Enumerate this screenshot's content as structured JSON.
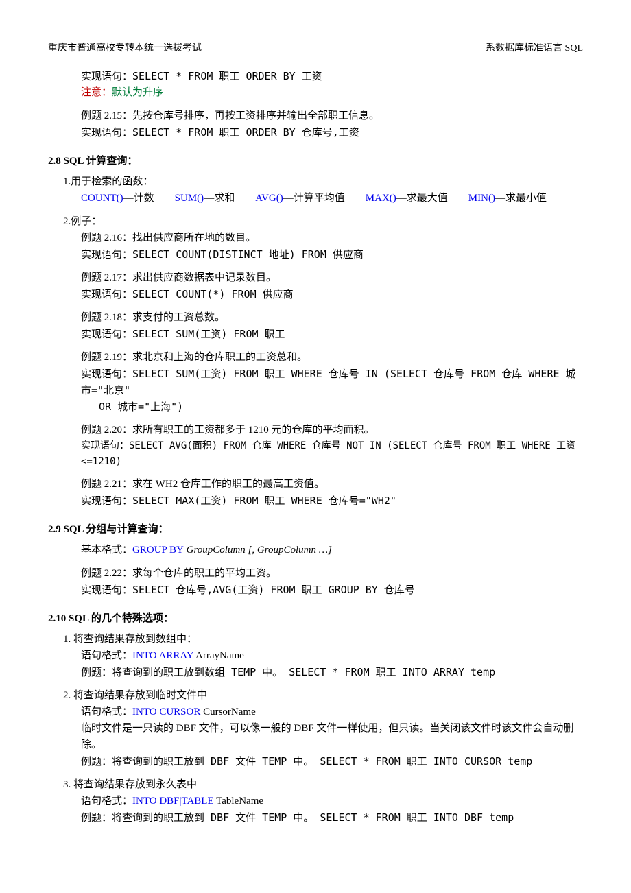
{
  "header": {
    "left": "重庆市普通高校专转本统一选拔考试",
    "right": "系数据库标准语言 SQL"
  },
  "top": {
    "l1": "实现语句：SELECT * FROM 职工 ORDER BY 工资",
    "l2a": "注意：",
    "l2b": "默认为升序",
    "l3": "例题 2.15：先按仓库号排序，再按工资排序并输出全部职工信息。",
    "l4": "实现语句：SELECT * FROM 职工 ORDER BY 仓库号,工资"
  },
  "s28": {
    "title": "2.8 SQL 计算查询：",
    "i1": "1.用于检索的函数：",
    "funcs": [
      {
        "fn": "COUNT()",
        "desc": "—计数"
      },
      {
        "fn": "SUM()",
        "desc": "—求和"
      },
      {
        "fn": "AVG()",
        "desc": "—计算平均值"
      },
      {
        "fn": "MAX()",
        "desc": "—求最大值"
      },
      {
        "fn": "MIN()",
        "desc": "—求最小值"
      }
    ],
    "i2": "2.例子：",
    "e16a": "例题 2.16：找出供应商所在地的数目。",
    "e16b": "实现语句：SELECT COUNT(DISTINCT 地址) FROM 供应商",
    "e17a": "例题 2.17：求出供应商数据表中记录数目。",
    "e17b": "实现语句：SELECT COUNT(*) FROM 供应商",
    "e18a": "例题 2.18：求支付的工资总数。",
    "e18b": "实现语句：SELECT SUM(工资) FROM 职工",
    "e19a": "例题 2.19：求北京和上海的仓库职工的工资总和。",
    "e19b": "实现语句：SELECT SUM(工资) FROM 职工 WHERE 仓库号 IN (SELECT 仓库号 FROM 仓库 WHERE 城市=\"北京\"",
    "e19c": "OR 城市=\"上海\")",
    "e20a": "例题 2.20：求所有职工的工资都多于 1210 元的仓库的平均面积。",
    "e20b": "实现语句：SELECT AVG(面积) FROM 仓库 WHERE 仓库号 NOT IN (SELECT 仓库号 FROM 职工 WHERE 工资<=1210)",
    "e21a": "例题 2.21：求在 WH2 仓库工作的职工的最高工资值。",
    "e21b": "实现语句：SELECT MAX(工资) FROM 职工 WHERE 仓库号=\"WH2\""
  },
  "s29": {
    "title": "2.9 SQL 分组与计算查询：",
    "fmt_pre": "基本格式：",
    "fmt_kw": "GROUP BY",
    "fmt_rest": " GroupColumn [, GroupColumn …]",
    "e22a": "例题 2.22：求每个仓库的职工的平均工资。",
    "e22b": "实现语句：SELECT 仓库号,AVG(工资) FROM 职工 GROUP BY 仓库号"
  },
  "s210": {
    "title": "2.10 SQL 的几个特殊选项：",
    "o1a": "1. 将查询结果存放到数组中：",
    "o1b_pre": "语句格式：",
    "o1b_kw": "INTO ARRAY",
    "o1b_rest": " ArrayName",
    "o1c": "例题：将查询到的职工放到数组 TEMP 中。   SELECT * FROM 职工 INTO ARRAY temp",
    "o2a": "2. 将查询结果存放到临时文件中",
    "o2b_pre": "语句格式：",
    "o2b_kw": "INTO CURSOR",
    "o2b_rest": " CursorName",
    "o2c": "临时文件是一只读的 DBF 文件，可以像一般的 DBF 文件一样使用，但只读。当关闭该文件时该文件会自动删除。",
    "o2d": "例题：将查询到的职工放到 DBF 文件 TEMP 中。   SELECT * FROM 职工 INTO CURSOR temp",
    "o3a": "3. 将查询结果存放到永久表中",
    "o3b_pre": "语句格式：",
    "o3b_kw": "INTO DBF|TABLE",
    "o3b_rest": " TableName",
    "o3c": "例题：将查询到的职工放到 DBF 文件 TEMP 中。   SELECT * FROM 职工 INTO DBF temp"
  }
}
